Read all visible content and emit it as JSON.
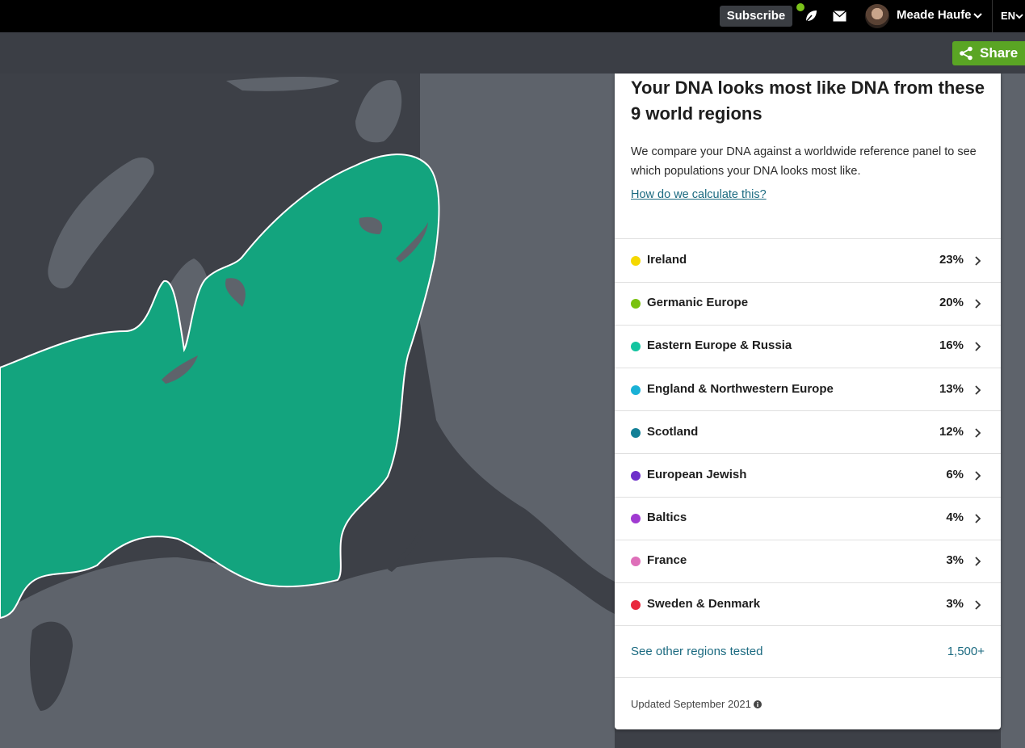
{
  "topbar": {
    "subscribe_label": "Subscribe",
    "user_name": "Meade Haufe",
    "language": "EN",
    "notification_color": "#7bc21a"
  },
  "share": {
    "label": "Share",
    "color": "#5aa524"
  },
  "panel": {
    "title": "Your DNA looks most like DNA from these 9 world regions",
    "description": "We compare your DNA against a worldwide reference panel to see which populations your DNA looks most like.",
    "calc_link": "How do we calculate this?",
    "regions": [
      {
        "name": "Ireland",
        "percent": "23%",
        "color": "#f5d800"
      },
      {
        "name": "Germanic Europe",
        "percent": "20%",
        "color": "#79c20f"
      },
      {
        "name": "Eastern Europe & Russia",
        "percent": "16%",
        "color": "#13c4a0"
      },
      {
        "name": "England & Northwestern Europe",
        "percent": "13%",
        "color": "#1ab1d6"
      },
      {
        "name": "Scotland",
        "percent": "12%",
        "color": "#138097"
      },
      {
        "name": "European Jewish",
        "percent": "6%",
        "color": "#6e2fca"
      },
      {
        "name": "Baltics",
        "percent": "4%",
        "color": "#a03ad1"
      },
      {
        "name": "France",
        "percent": "3%",
        "color": "#de6fb9"
      },
      {
        "name": "Sweden & Denmark",
        "percent": "3%",
        "color": "#e9283d"
      }
    ],
    "other_regions_label": "See other regions tested",
    "other_regions_count": "1,500+",
    "updated": "Updated September 2021"
  },
  "map": {
    "highlight_region": "Eastern Europe & Russia",
    "highlight_color": "#13a47e",
    "land_color": "#5e636b",
    "sea_color": "#3d4047"
  }
}
